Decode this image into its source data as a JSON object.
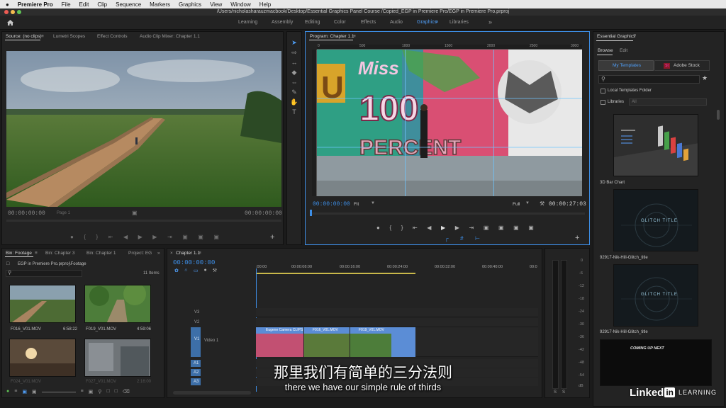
{
  "menu": {
    "apple": "",
    "app": "Premiere Pro",
    "items": [
      "File",
      "Edit",
      "Clip",
      "Sequence",
      "Markers",
      "Graphics",
      "View",
      "Window",
      "Help"
    ]
  },
  "titlebar": {
    "path": "/Users/nicholasharauzmacbook/Desktop/Essential Graphics Panel Course /Copied_EGP in Premiere Pro/EGP in Premiere Pro.prproj"
  },
  "workspaces": {
    "tabs": [
      "Learning",
      "Assembly",
      "Editing",
      "Color",
      "Effects",
      "Audio",
      "Graphics",
      "Libraries"
    ],
    "active": "Graphics",
    "more": "»"
  },
  "source_monitor": {
    "tabs": [
      "Source: (no clips)",
      "Lumetri Scopes",
      "Effect Controls",
      "Audio Clip Mixer: Chapter 1.1"
    ],
    "timecode_left": "00:00:00:00",
    "page_label": "Page 1",
    "timecode_right": "00:00:00:00"
  },
  "program_monitor": {
    "title": "Program: Chapter 1.1",
    "timecode_left": "00:00:00:00",
    "fit": "Fit",
    "quality": "Full",
    "timecode_right": "00:00:27:03",
    "ruler_labels": [
      "0",
      "500",
      "1000",
      "1500",
      "2000",
      "2500",
      "3000"
    ]
  },
  "project_panel": {
    "tabs": [
      "Bin: Footage",
      "Bin: Chapter 3",
      "Bin: Chapter 1",
      "Project: EG"
    ],
    "path": "EGP in Premiere Pro.prproj\\Footage",
    "items_count": "11 Items",
    "clips": [
      {
        "name": "F016_V01.MOV",
        "duration": "6:58:22"
      },
      {
        "name": "F019_V01.MOV",
        "duration": "4:59:06"
      },
      {
        "name": "F024_V01.MOV",
        "duration": ""
      },
      {
        "name": "F027_V01.MOV",
        "duration": "2:16:00"
      }
    ]
  },
  "timeline": {
    "tab": "Chapter 1.1",
    "timecode": "00:00:00:00",
    "ruler": [
      ":00:00",
      "00:00:08:00",
      "00:00:16:00",
      "00:00:24:00",
      "00:00:32:00",
      "00:00:40:00",
      "00:0"
    ],
    "tracks": [
      "V3",
      "V2",
      "V1",
      "A1",
      "A2",
      "A3"
    ],
    "v1_name": "Video 1",
    "clips": [
      "Eugene Camera CLIPS",
      "F016_V01.MOV",
      "F019_V01.MOV"
    ]
  },
  "audio_meter": {
    "ticks": [
      "0",
      "-6",
      "-12",
      "-18",
      "-24",
      "-30",
      "-36",
      "-42",
      "-48",
      "-54",
      "dB"
    ],
    "solo": [
      "S",
      "S"
    ]
  },
  "essential_graphics": {
    "title": "Essential Graphics",
    "tabs": [
      "Browse",
      "Edit"
    ],
    "my_templates": "My Templates",
    "adobe_stock": "Adobe Stock",
    "local_folder": "Local Templates Folder",
    "libraries": "Libraries",
    "libraries_value": "All",
    "templates": [
      "3D Bar Chart",
      "92917-Nik-Hill-Glitch_title",
      "92917-Nik-Hill-Glitch_title"
    ],
    "glitch_text": "GLITCH TITLE",
    "coming_up_text": "COMING UP NEXT"
  },
  "subtitles": {
    "cn": "那里我们有简单的三分法则",
    "en": "there we have our simple rule of thirds"
  },
  "watermark": {
    "brand_a": "Linked",
    "brand_b": "in",
    "brand_c": "LEARNING"
  },
  "colors": {
    "accent": "#3d8ee6",
    "panel_bg": "#232323",
    "clip_blue": "#5b8dd6"
  }
}
